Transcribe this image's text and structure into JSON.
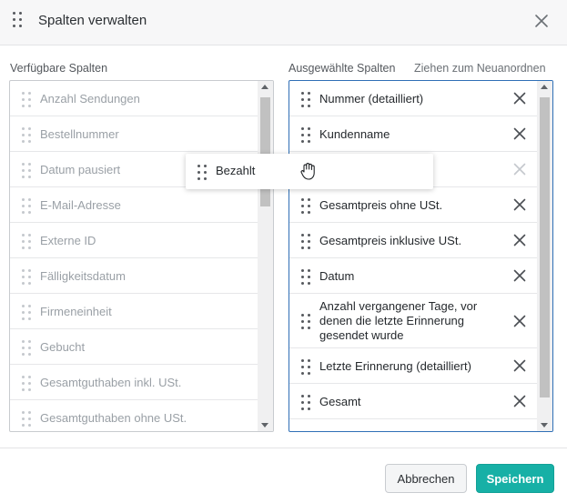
{
  "dialog": {
    "title": "Spalten verwalten",
    "icons": {
      "drag_handle": "drag-handle-icon",
      "close": "close-icon"
    }
  },
  "available": {
    "label": "Verfügbare Spalten",
    "items": [
      "Anzahl Sendungen",
      "Bestellnummer",
      "Datum pausiert",
      "E-Mail-Adresse",
      "Externe ID",
      "Fälligkeitsdatum",
      "Firmeneinheit",
      "Gebucht",
      "Gesamtguthaben inkl. USt.",
      "Gesamtguthaben ohne USt."
    ]
  },
  "selected": {
    "label": "Ausgewählte Spalten",
    "hint": "Ziehen zum Neuanordnen",
    "items": [
      "Nummer (detailliert)",
      "Kundenname",
      "",
      "Gesamtpreis ohne USt.",
      "Gesamtpreis inklusive USt.",
      "Datum",
      "Anzahl vergangener Tage, vor denen die letzte Erinnerung gesendet wurde",
      "Letzte Erinnerung (detailliert)",
      "Gesamt"
    ]
  },
  "drag": {
    "label": "Bezahlt",
    "icon": "grab-hand-icon"
  },
  "footer": {
    "cancel_label": "Abbrechen",
    "save_label": "Speichern"
  },
  "colors": {
    "accent": "#17b0a6",
    "focus_border": "#2f6fb6"
  }
}
